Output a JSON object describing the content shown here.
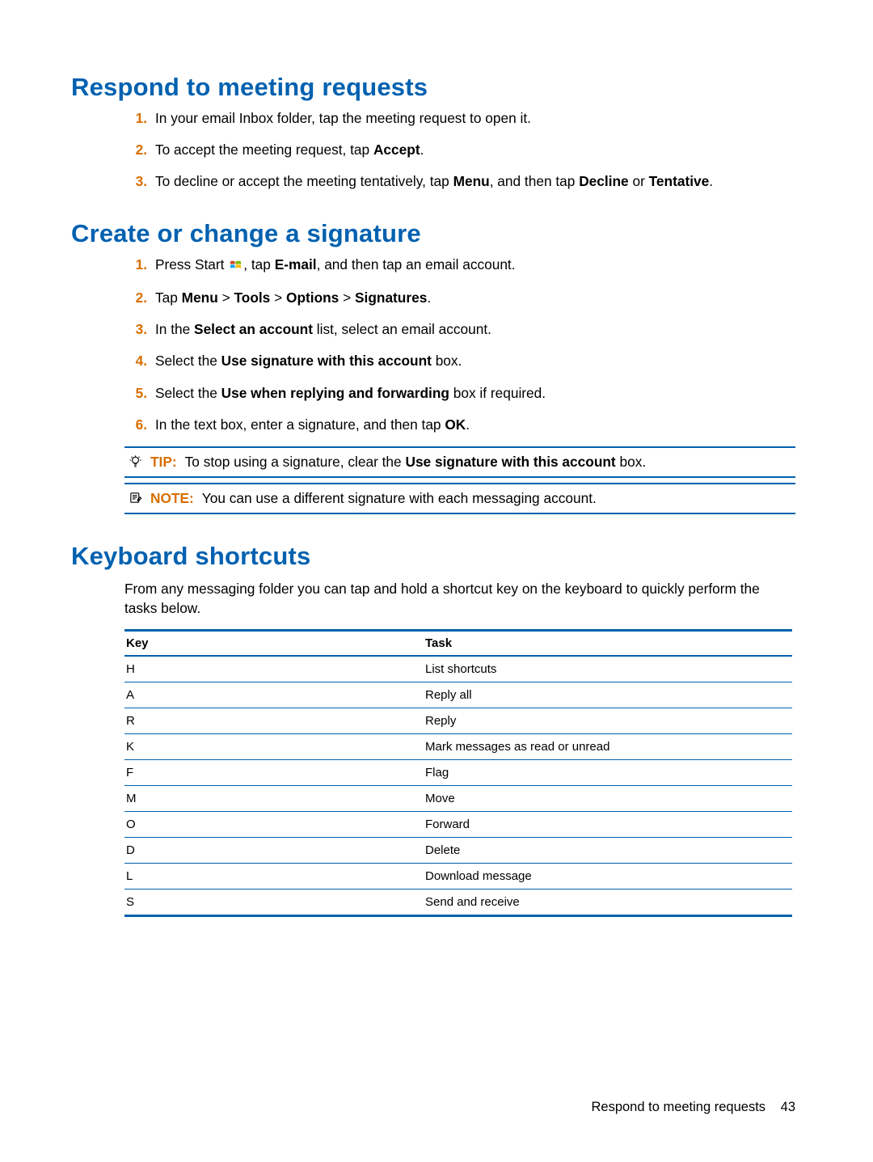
{
  "sections": {
    "s1": {
      "heading": "Respond to meeting requests",
      "items": [
        {
          "num": "1.",
          "html": "In your email Inbox folder, tap the meeting request to open it."
        },
        {
          "num": "2.",
          "html": "To accept the meeting request, tap <b>Accept</b>."
        },
        {
          "num": "3.",
          "html": "To decline or accept the meeting tentatively, tap <b>Menu</b>, and then tap <b>Decline</b> or <b>Tentative</b>."
        }
      ]
    },
    "s2": {
      "heading": "Create or change a signature",
      "items": [
        {
          "num": "1.",
          "html": "Press Start {{FLAG}}, tap <b>E-mail</b>, and then tap an email account."
        },
        {
          "num": "2.",
          "html": "Tap <b>Menu</b> > <b>Tools</b> > <b>Options</b> > <b>Signatures</b>."
        },
        {
          "num": "3.",
          "html": "In the <b>Select an account</b> list, select an email account."
        },
        {
          "num": "4.",
          "html": "Select the <b>Use signature with this account</b> box."
        },
        {
          "num": "5.",
          "html": "Select the <b>Use when replying and forwarding</b> box if required."
        },
        {
          "num": "6.",
          "html": "In the text box, enter a signature, and then tap <b>OK</b>."
        }
      ],
      "tip": {
        "label": "TIP:",
        "html": "To stop using a signature, clear the <b>Use signature with this account</b> box."
      },
      "note": {
        "label": "NOTE:",
        "html": "You can use a different signature with each messaging account."
      }
    },
    "s3": {
      "heading": "Keyboard shortcuts",
      "intro": "From any messaging folder you can tap and hold a shortcut key on the keyboard to quickly perform the tasks below.",
      "headers": {
        "key": "Key",
        "task": "Task"
      },
      "rows": [
        {
          "k": "H",
          "t": "List shortcuts"
        },
        {
          "k": "A",
          "t": "Reply all"
        },
        {
          "k": "R",
          "t": "Reply"
        },
        {
          "k": "K",
          "t": "Mark messages as read or unread"
        },
        {
          "k": "F",
          "t": "Flag"
        },
        {
          "k": "M",
          "t": "Move"
        },
        {
          "k": "O",
          "t": "Forward"
        },
        {
          "k": "D",
          "t": "Delete"
        },
        {
          "k": "L",
          "t": "Download message"
        },
        {
          "k": "S",
          "t": "Send and receive"
        }
      ]
    }
  },
  "footer": {
    "title": "Respond to meeting requests",
    "page": "43"
  }
}
